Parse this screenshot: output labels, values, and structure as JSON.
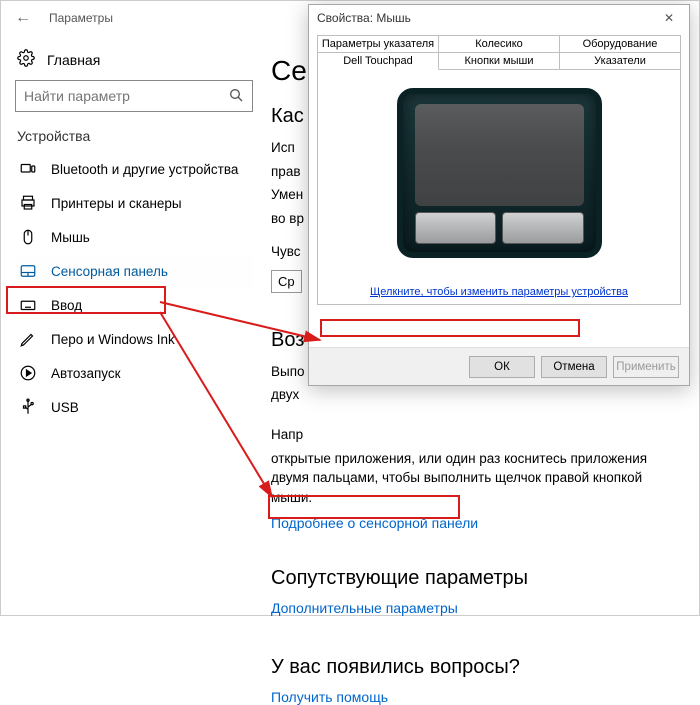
{
  "settings": {
    "title": "Параметры",
    "home": "Главная",
    "searchPlaceholder": "Найти параметр",
    "sectionLabel": "Устройства",
    "items": [
      {
        "label": "Bluetooth и другие устройства"
      },
      {
        "label": "Принтеры и сканеры"
      },
      {
        "label": "Мышь"
      },
      {
        "label": "Сенсорная панель"
      },
      {
        "label": "Ввод"
      },
      {
        "label": "Перо и Windows Ink"
      },
      {
        "label": "Автозапуск"
      },
      {
        "label": "USB"
      }
    ]
  },
  "content": {
    "h1": "Се",
    "h2a": "Кас",
    "p1": "Исп",
    "p2": "прав",
    "p3": "Умен",
    "p4": "во вр",
    "sensLabel": "Чувс",
    "sensValue": "Ср",
    "h2b": "Воз",
    "p5": "Выпо",
    "p6": "двух",
    "p7": "Напр",
    "p8": "открытые приложения, или один раз коснитесь приложения двумя пальцами, чтобы выполнить щелчок правой кнопкой мыши.",
    "moreLink": "Подробнее о сенсорной панели",
    "relatedHeading": "Сопутствующие параметры",
    "extraLink": "Дополнительные параметры",
    "faqHeading": "У вас появились вопросы?",
    "helpLink": "Получить помощь"
  },
  "dlg": {
    "title": "Свойства: Мышь",
    "tabsRow1": [
      "Параметры указателя",
      "Колесико",
      "Оборудование"
    ],
    "tabsRow2": [
      "Dell Touchpad",
      "Кнопки мыши",
      "Указатели"
    ],
    "changeLink": "Щелкните, чтобы изменить параметры устройства",
    "ok": "ОК",
    "cancel": "Отмена",
    "apply": "Применить"
  }
}
